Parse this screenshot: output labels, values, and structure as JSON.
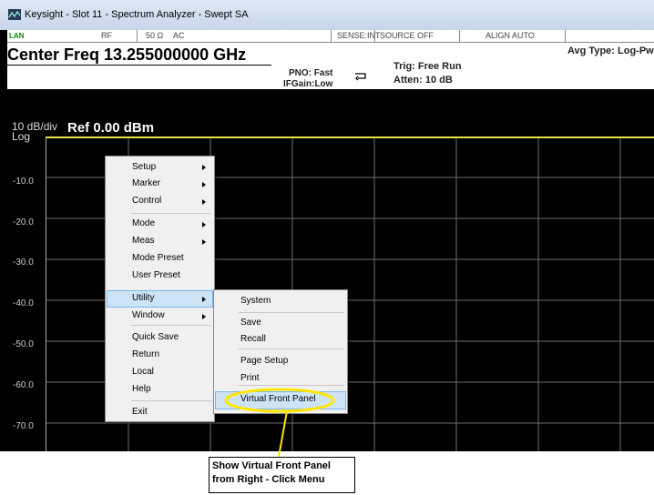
{
  "window": {
    "title": "Keysight - Slot 11 - Spectrum Analyzer - Swept SA"
  },
  "status_bar": {
    "lan": "LAN",
    "rf": "RF",
    "impedance": "50 Ω",
    "coupling": "AC",
    "sense": "SENSE:INT",
    "source": "SOURCE OFF",
    "align": "ALIGN AUTO"
  },
  "settings": {
    "center_freq": "Center Freq 13.255000000 GHz",
    "pno": "PNO: Fast",
    "ifgain": "IFGain:Low",
    "trig": "Trig: Free Run",
    "atten": "Atten: 10 dB",
    "avg_type": "Avg Type: Log-Pw"
  },
  "plot": {
    "scale": "10 dB/div",
    "scale_type": "Log",
    "ref_level": "Ref 0.00 dBm",
    "y_ticks": [
      "-10.0",
      "-20.0",
      "-30.0",
      "-40.0",
      "-50.0",
      "-60.0",
      "-70.0"
    ],
    "trace_color": "#e6e24a"
  },
  "context_menu": {
    "items": [
      "Setup",
      "Marker",
      "Control",
      "Mode",
      "Meas",
      "Mode Preset",
      "User Preset",
      "Utility",
      "Window",
      "Quick Save",
      "Return",
      "Local",
      "Help",
      "Exit"
    ],
    "highlighted": "Utility"
  },
  "utility_submenu": {
    "items": [
      "System",
      "Save",
      "Recall",
      "Page Setup",
      "Print",
      "Virtual Front Panel"
    ],
    "highlighted": "Virtual Front Panel"
  },
  "annotation": {
    "line1": "Show Virtual Front Panel",
    "line2": "from Right - Click Menu",
    "color": "#ffe600"
  }
}
